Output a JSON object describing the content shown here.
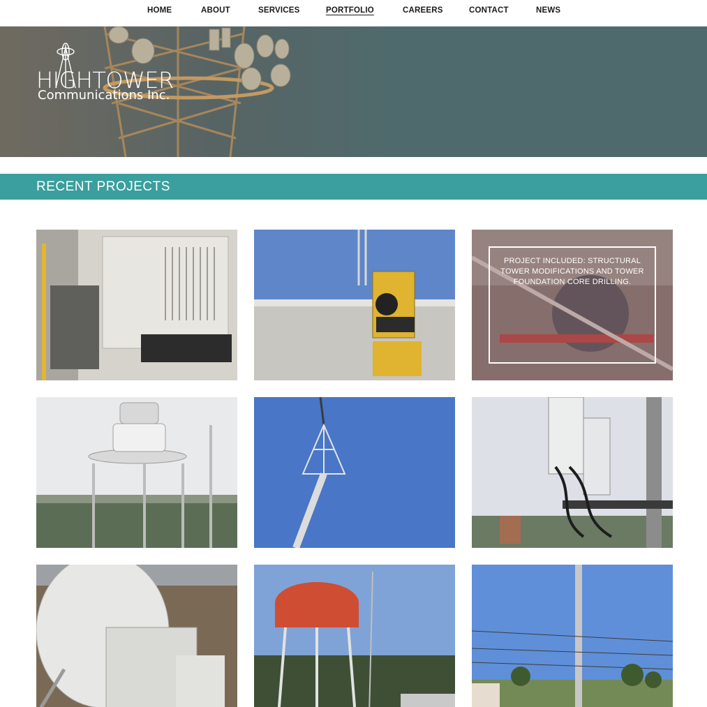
{
  "nav": {
    "items": [
      {
        "label": "HOME"
      },
      {
        "label": "ABOUT"
      },
      {
        "label": "SERVICES"
      },
      {
        "label": "PORTFOLIO"
      },
      {
        "label": "CAREERS"
      },
      {
        "label": "CONTACT"
      },
      {
        "label": "NEWS"
      }
    ],
    "active": "PORTFOLIO"
  },
  "logo": {
    "title": "HIGHTOWER",
    "subtitle": "Communications Inc."
  },
  "section": {
    "title": "RECENT PROJECTS"
  },
  "projects": [
    {
      "caption": ""
    },
    {
      "caption": ""
    },
    {
      "caption": "PROJECT INCLUDED: STRUCTURAL TOWER MODIFICATIONS AND TOWER FOUNDATION CORE DRILLING."
    },
    {
      "caption": ""
    },
    {
      "caption": ""
    },
    {
      "caption": ""
    },
    {
      "caption": ""
    },
    {
      "caption": ""
    },
    {
      "caption": ""
    }
  ],
  "colors": {
    "accent": "#3a9f9e",
    "nav_text": "#1a1a1a"
  }
}
